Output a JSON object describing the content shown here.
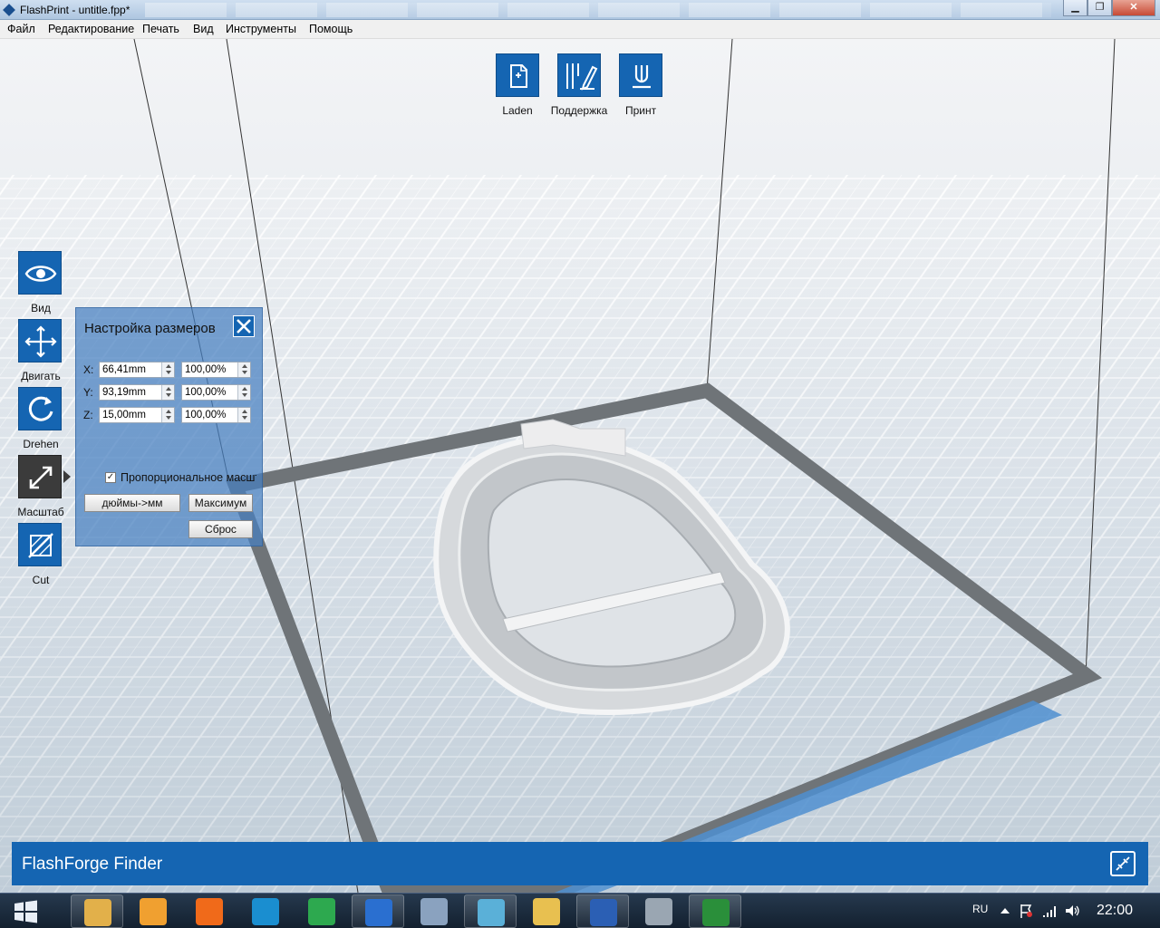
{
  "window": {
    "title": "FlashPrint - untitle.fpp*",
    "minimize_glyph": "▁",
    "maximize_glyph": "❐",
    "close_glyph": "✕"
  },
  "menu": [
    "Файл",
    "Редактирование",
    "Печать",
    "Вид",
    "Инструменты",
    "Помощь"
  ],
  "top_toolbar": [
    {
      "label": "Laden",
      "icon": "load-file-icon"
    },
    {
      "label": "Поддержка",
      "icon": "support-icon"
    },
    {
      "label": "Принт",
      "icon": "print-icon"
    }
  ],
  "side_toolbar": [
    {
      "label": "Вид",
      "icon": "eye-icon",
      "active": false
    },
    {
      "label": "Двигать",
      "icon": "move-arrows-icon",
      "active": false
    },
    {
      "label": "Drehen",
      "icon": "rotate-icon",
      "active": false
    },
    {
      "label": "Масштаб",
      "icon": "scale-icon",
      "active": true
    },
    {
      "label": "Cut",
      "icon": "cut-icon",
      "active": false
    }
  ],
  "scale_panel": {
    "title": "Настройка размеров",
    "rows": [
      {
        "axis": "X:",
        "size": "66,41mm",
        "percent": "100,00%"
      },
      {
        "axis": "Y:",
        "size": "93,19mm",
        "percent": "100,00%"
      },
      {
        "axis": "Z:",
        "size": "15,00mm",
        "percent": "100,00%"
      }
    ],
    "proportional_label": "Пропорциональное масштабирование",
    "proportional_checked": true,
    "inch_to_mm_label": "дюймы->мм",
    "maximum_label": "Максимум",
    "reset_label": "Сброс"
  },
  "finder": {
    "title": "FlashForge Finder"
  },
  "taskbar": {
    "apps": [
      {
        "name": "explorer",
        "color": "#e2b04a",
        "open": true
      },
      {
        "name": "media-player",
        "color": "#f0a030",
        "open": false
      },
      {
        "name": "origin",
        "color": "#f06a1a",
        "open": false
      },
      {
        "name": "ccleaner",
        "color": "#1a8ed0",
        "open": false
      },
      {
        "name": "chrome",
        "color": "#2da94f",
        "open": false
      },
      {
        "name": "flashprint",
        "color": "#2a6fd0",
        "open": true
      },
      {
        "name": "calculator",
        "color": "#8aa2bf",
        "open": false
      },
      {
        "name": "notepad",
        "color": "#5ab0d8",
        "open": true
      },
      {
        "name": "paint",
        "color": "#e8c050",
        "open": false
      },
      {
        "name": "word",
        "color": "#2b5fb4",
        "open": true
      },
      {
        "name": "network",
        "color": "#9aa6b2",
        "open": false
      },
      {
        "name": "excel",
        "color": "#2a8f3a",
        "open": true
      }
    ],
    "language": "RU",
    "clock": "22:00"
  }
}
